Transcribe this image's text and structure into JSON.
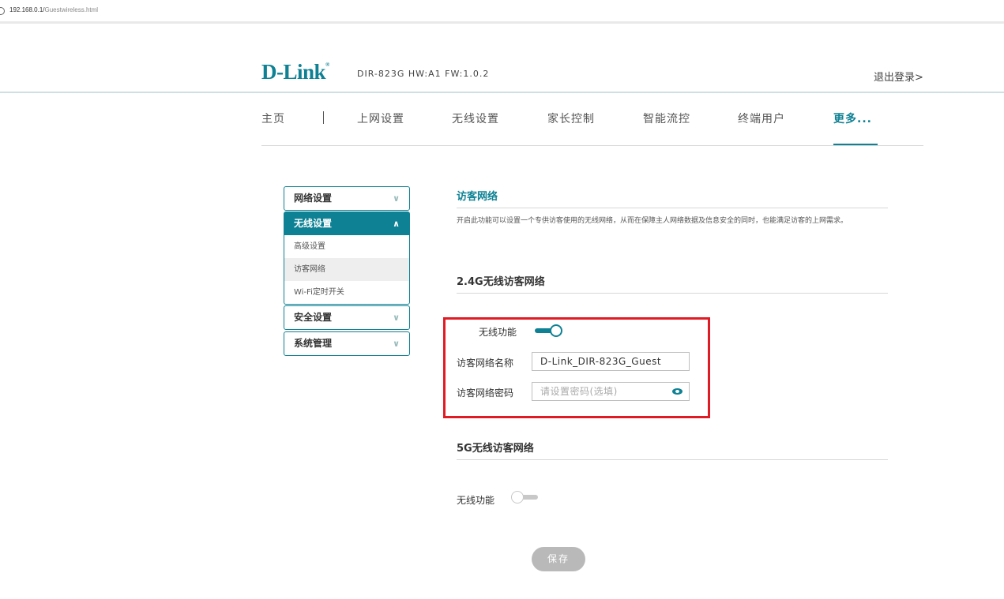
{
  "browser": {
    "url_host": "192.168.0.1/",
    "url_path": "Guestwireless.html",
    "page_icon": "info-circle-icon"
  },
  "header": {
    "brand": "D-Link",
    "brand_mark": "®",
    "model_info": "DIR-823G  HW:A1  FW:1.0.2",
    "logout_label": "退出登录>"
  },
  "nav": {
    "items": [
      "主页",
      "上网设置",
      "无线设置",
      "家长控制",
      "智能流控",
      "终端用户",
      "更多..."
    ],
    "active": "更多..."
  },
  "sidebar": {
    "network": "网络设置",
    "wireless": "无线设置",
    "wireless_items": [
      "高级设置",
      "访客网络",
      "Wi-Fi定时开关"
    ],
    "active_item": "访客网络",
    "security": "安全设置",
    "system": "系统管理",
    "chevron_down": "∨",
    "chevron_up": "∧"
  },
  "main": {
    "title": "访客网络",
    "description": "开启此功能可以设置一个专供访客使用的无线网络，从而在保障主人网络数据及信息安全的同时，也能满足访客的上网需求。",
    "section_24g": {
      "title": "2.4G无线访客网络",
      "wireless_label": "无线功能",
      "wireless_enabled": true,
      "ssid_label": "访客网络名称",
      "ssid_value": "D-Link_DIR-823G_Guest",
      "password_label": "访客网络密码",
      "password_placeholder": "请设置密码(选填)",
      "password_value": ""
    },
    "section_5g": {
      "title": "5G无线访客网络",
      "wireless_label": "无线功能",
      "wireless_enabled": false
    },
    "save_label": "保存"
  },
  "colors": {
    "accent": "#0e8194",
    "highlight_box": "#e01b24",
    "save_button": "#b9b9b9"
  }
}
